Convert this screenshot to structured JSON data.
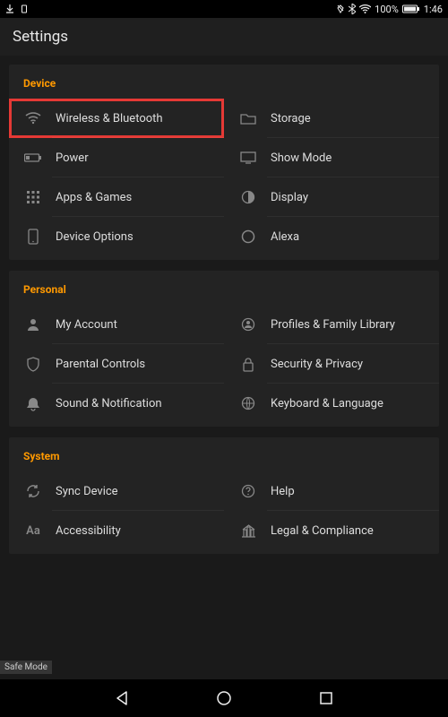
{
  "statusbar": {
    "battery_text": "100%",
    "time": "1:46"
  },
  "header": {
    "title": "Settings"
  },
  "sections": [
    {
      "title": "Device",
      "rows": [
        {
          "left": {
            "icon": "wifi-icon",
            "label": "Wireless & Bluetooth",
            "highlight": true
          },
          "right": {
            "icon": "folder-icon",
            "label": "Storage"
          }
        },
        {
          "left": {
            "icon": "battery-icon",
            "label": "Power"
          },
          "right": {
            "icon": "monitor-icon",
            "label": "Show Mode"
          }
        },
        {
          "left": {
            "icon": "apps-icon",
            "label": "Apps & Games"
          },
          "right": {
            "icon": "contrast-icon",
            "label": "Display"
          }
        },
        {
          "left": {
            "icon": "device-icon",
            "label": "Device Options"
          },
          "right": {
            "icon": "circle-icon",
            "label": "Alexa"
          }
        }
      ]
    },
    {
      "title": "Personal",
      "rows": [
        {
          "left": {
            "icon": "person-icon",
            "label": "My Account"
          },
          "right": {
            "icon": "profiles-icon",
            "label": "Profiles & Family Library"
          }
        },
        {
          "left": {
            "icon": "shield-icon",
            "label": "Parental Controls"
          },
          "right": {
            "icon": "lock-icon",
            "label": "Security & Privacy"
          }
        },
        {
          "left": {
            "icon": "bell-icon",
            "label": "Sound & Notification"
          },
          "right": {
            "icon": "globe-icon",
            "label": "Keyboard & Language"
          }
        }
      ]
    },
    {
      "title": "System",
      "rows": [
        {
          "left": {
            "icon": "sync-icon",
            "label": "Sync Device"
          },
          "right": {
            "icon": "help-icon",
            "label": "Help"
          }
        },
        {
          "left": {
            "icon": "aa-icon",
            "label": "Accessibility"
          },
          "right": {
            "icon": "legal-icon",
            "label": "Legal & Compliance"
          }
        }
      ]
    }
  ],
  "safe_mode": "Safe Mode"
}
